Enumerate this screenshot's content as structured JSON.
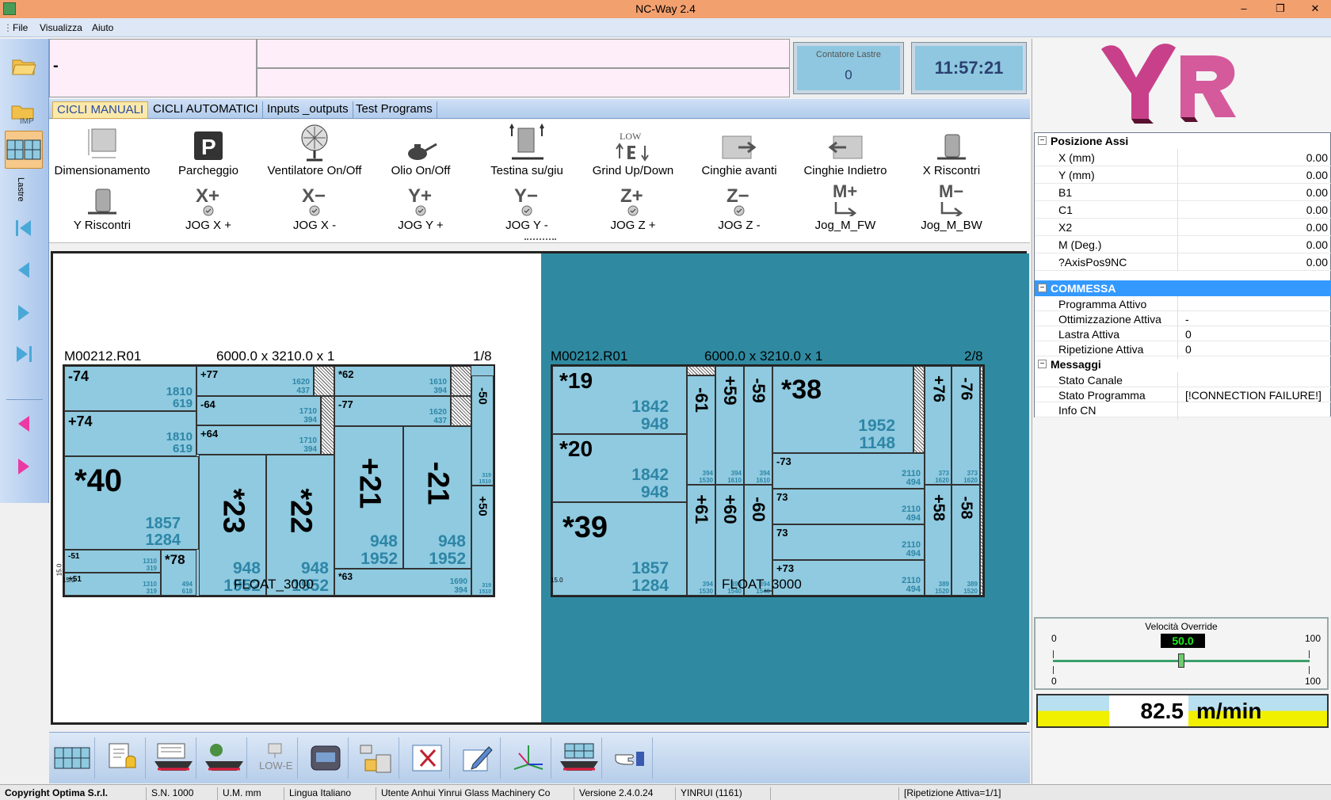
{
  "window": {
    "title": "NC-Way 2.4"
  },
  "menu": [
    "File",
    "Visualizza",
    "Aiuto"
  ],
  "left_toolbar": {
    "vertical_label": "Lastre"
  },
  "info": {
    "field_a": "-",
    "field_b": "",
    "field_c": ""
  },
  "counter": {
    "label": "Contatore Lastre",
    "value": "0"
  },
  "clock": "11:57:21",
  "tabs": [
    "CICLI MANUALI",
    "CICLI AUTOMATICI",
    "Inputs _outputs",
    "Test Programs"
  ],
  "manual_cycles": {
    "row1": [
      "Dimensionamento",
      "Parcheggio",
      "Ventilatore On/Off",
      "Olio On/Off",
      "Testina su/giu",
      "Grind Up/Down",
      "Cinghie avanti",
      "Cinghie Indietro",
      "X Riscontri"
    ],
    "row2": [
      "Y Riscontri",
      "JOG X +",
      "JOG X -",
      "JOG Y +",
      "JOG Y -",
      "JOG Z +",
      "JOG Z -",
      "Jog_M_FW",
      "Jog_M_BW"
    ],
    "icon_glyphs": {
      "park": "P",
      "low": "LOW",
      "xplus": "X+",
      "xminus": "X−",
      "yplus": "Y+",
      "yminus": "Y−",
      "zplus": "Z+",
      "zminus": "Z−",
      "mplus": "M+",
      "mminus": "M−"
    }
  },
  "sheets": [
    {
      "code": "M00212.R01",
      "dims": "6000.0  x  3210.0 x 1",
      "index": "1/8",
      "material": "FLOAT_3000",
      "trim": "15.0",
      "trim2": "15.0"
    },
    {
      "code": "M00212.R01",
      "dims": "6000.0  x  3210.0 x 1",
      "index": "2/8",
      "material": "FLOAT_3000",
      "trim": "15.0"
    }
  ],
  "pieces1": [
    {
      "n": "-74",
      "d1": "1810",
      "d2": "619"
    },
    {
      "n": "+74",
      "d1": "1810",
      "d2": "619"
    },
    {
      "n": "*40",
      "d1": "1857",
      "d2": "1284"
    },
    {
      "n": "-51",
      "d1": "1310",
      "d2": "319"
    },
    {
      "n": "+51",
      "d1": "1310",
      "d2": "319"
    },
    {
      "n": "*78",
      "d1": "494",
      "d2": "618"
    },
    {
      "n": "+77",
      "d1": "1620",
      "d2": "437"
    },
    {
      "n": "-64",
      "d1": "1710",
      "d2": "394"
    },
    {
      "n": "+64",
      "d1": "1710",
      "d2": "394"
    },
    {
      "n": "*23",
      "d1": "948",
      "d2": "1952"
    },
    {
      "n": "*22",
      "d1": "948",
      "d2": "1952"
    },
    {
      "n": "*62",
      "d1": "1610",
      "d2": "394"
    },
    {
      "n": "-77",
      "d1": "1620",
      "d2": "437"
    },
    {
      "n": "+21",
      "d1": "948",
      "d2": "1952"
    },
    {
      "n": "-21",
      "d1": "948",
      "d2": "1952"
    },
    {
      "n": "*63",
      "d1": "1690",
      "d2": "394"
    },
    {
      "n": "-50",
      "d1": "319",
      "d2": "1510"
    },
    {
      "n": "+50",
      "d1": "319",
      "d2": "1510"
    }
  ],
  "pieces2": [
    {
      "n": "*19",
      "d1": "1842",
      "d2": "948"
    },
    {
      "n": "*20",
      "d1": "1842",
      "d2": "948"
    },
    {
      "n": "*39",
      "d1": "1857",
      "d2": "1284"
    },
    {
      "n": "-61",
      "d1": "394",
      "d2": "1530"
    },
    {
      "n": "+59",
      "d1": "394",
      "d2": "1610"
    },
    {
      "n": "-59",
      "d1": "394",
      "d2": "1610"
    },
    {
      "n": "+61",
      "d1": "394",
      "d2": "1530"
    },
    {
      "n": "+60",
      "d1": "394",
      "d2": "1540"
    },
    {
      "n": "-60",
      "d1": "394",
      "d2": "1540"
    },
    {
      "n": "*38",
      "d1": "1952",
      "d2": "1148"
    },
    {
      "n": "-73",
      "d1": "2110",
      "d2": "494"
    },
    {
      "n": "73",
      "d1": "2110",
      "d2": "494"
    },
    {
      "n": "73",
      "d1": "2110",
      "d2": "494"
    },
    {
      "n": "+73",
      "d1": "2110",
      "d2": "494"
    },
    {
      "n": "+76",
      "d1": "373",
      "d2": "1620"
    },
    {
      "n": "-76",
      "d1": "373",
      "d2": "1620"
    },
    {
      "n": "+58",
      "d1": "389",
      "d2": "1520"
    },
    {
      "n": "-58",
      "d1": "389",
      "d2": "1520"
    }
  ],
  "axes": {
    "title": "Posizione Assi",
    "rows": [
      {
        "k": "X (mm)",
        "v": "0.00"
      },
      {
        "k": "Y (mm)",
        "v": "0.00"
      },
      {
        "k": "B1",
        "v": "0.00"
      },
      {
        "k": "C1",
        "v": "0.00"
      },
      {
        "k": "X2",
        "v": "0.00"
      },
      {
        "k": "M (Deg.)",
        "v": "0.00"
      },
      {
        "k": "?AxisPos9NC",
        "v": "0.00"
      }
    ]
  },
  "commessa": {
    "title": "COMMESSA",
    "rows": [
      {
        "k": "Programma Attivo",
        "v": ""
      },
      {
        "k": "Ottimizzazione Attiva",
        "v": "-"
      },
      {
        "k": "Lastra Attiva",
        "v": "0"
      },
      {
        "k": "Ripetizione Attiva",
        "v": "0"
      }
    ]
  },
  "messaggi": {
    "title": "Messaggi",
    "rows": [
      {
        "k": "Stato Canale",
        "v": ""
      },
      {
        "k": "Stato Programma",
        "v": "[!CONNECTION FAILURE!]"
      },
      {
        "k": "Info CN",
        "v": ""
      }
    ]
  },
  "velocity": {
    "title": "Velocità Override",
    "min": "0",
    "max": "100",
    "value": "50.0",
    "level": 50
  },
  "speed": {
    "value": "82.5",
    "unit": "m/min"
  },
  "bottom_toolbar": {
    "low_e": "LOW-E"
  },
  "status": [
    "Copyright Optima S.r.l.",
    "S.N. 1000",
    "U.M. mm",
    "Lingua Italiano",
    "Utente Anhui Yinrui Glass Machinery Co",
    "Versione 2.4.0.24",
    "YINRUI (1161)",
    "",
    "[Ripetizione Attiva=1/1]"
  ],
  "colors": {
    "title": "#f3a06f",
    "piece": "#8fcae0",
    "piece_dim": "#2e86a6",
    "active_bg": "#2f8aa1",
    "speed_yellow": "#f0f000"
  }
}
